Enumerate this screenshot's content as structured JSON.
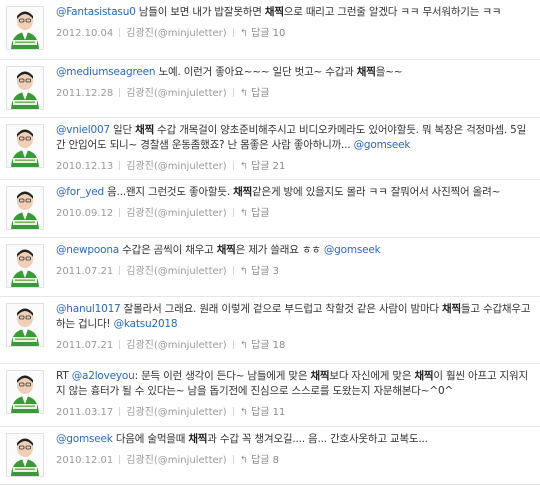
{
  "tweets": [
    {
      "segments": [
        {
          "t": "mention",
          "v": "@Fantasistasu0"
        },
        {
          "t": "text",
          "v": " 남들이 보면 내가 밥잘못하면 "
        },
        {
          "t": "bold",
          "v": "채찍"
        },
        {
          "t": "text",
          "v": "으로 때리고 그런줄 알겠다 ㅋㅋ 무서워하기는 ㅋㅋ"
        }
      ],
      "date": "2012.10.04",
      "author": "김광진(@minjuletter)",
      "reply": "답글 10"
    },
    {
      "segments": [
        {
          "t": "mention",
          "v": "@mediumseagreen"
        },
        {
          "t": "text",
          "v": " 노예. 이런거 좋아요~~~ 일단 벗고~ 수갑과 "
        },
        {
          "t": "bold",
          "v": "채찍"
        },
        {
          "t": "text",
          "v": "을~~"
        }
      ],
      "date": "2011.12.28",
      "author": "김광진(@minjuletter)",
      "reply": "답글"
    },
    {
      "segments": [
        {
          "t": "mention",
          "v": "@vniel007"
        },
        {
          "t": "text",
          "v": " 일단 "
        },
        {
          "t": "bold",
          "v": "채찍"
        },
        {
          "t": "text",
          "v": " 수갑 개목걸이 양초준비해주시고 비디오카메라도 있어야할듯. 뭐 복장은 걱정마셈. 5일간 안입어도 되니~ 경찰샘 운동좀했죠? 난 몸좋은 사람 좋아하니까... "
        },
        {
          "t": "mention",
          "v": "@gomseek"
        }
      ],
      "date": "2010.12.13",
      "author": "김광진(@minjuletter)",
      "reply": "답글 21"
    },
    {
      "segments": [
        {
          "t": "mention",
          "v": "@for_yed"
        },
        {
          "t": "text",
          "v": " 음...왠지 그런것도 좋아할듯. "
        },
        {
          "t": "bold",
          "v": "채찍"
        },
        {
          "t": "text",
          "v": "같은게 방에 있을지도 몰라 ㅋㅋ 잘뭐어서 사진찍어 올려~"
        }
      ],
      "date": "2010.09.12",
      "author": "김광진(@minjuletter)",
      "reply": "답글"
    },
    {
      "segments": [
        {
          "t": "mention",
          "v": "@newpoona"
        },
        {
          "t": "text",
          "v": " 수갑은 곰씩이 채우고 "
        },
        {
          "t": "bold",
          "v": "채찍"
        },
        {
          "t": "text",
          "v": "은 제가 쓸래요 ㅎㅎ "
        },
        {
          "t": "mention",
          "v": "@gomseek"
        }
      ],
      "date": "2011.07.21",
      "author": "김광진(@minjuletter)",
      "reply": "답글 3"
    },
    {
      "segments": [
        {
          "t": "mention",
          "v": "@hanul1017"
        },
        {
          "t": "text",
          "v": " 잘몰라서 그래요. 원래 이렇게 겉으로 부드럽고 착할것 같은 사람이 밤마다 "
        },
        {
          "t": "bold",
          "v": "채찍"
        },
        {
          "t": "text",
          "v": "들고 수갑채우고 하는 겁니다! "
        },
        {
          "t": "mention",
          "v": "@katsu2018"
        }
      ],
      "date": "2011.07.21",
      "author": "김광진(@minjuletter)",
      "reply": "답글 18"
    },
    {
      "segments": [
        {
          "t": "text",
          "v": "RT "
        },
        {
          "t": "mention",
          "v": "@a2loveyou"
        },
        {
          "t": "text",
          "v": ": 문득 이런 생각이 든다~ 남들에게 맞은 "
        },
        {
          "t": "bold",
          "v": "채찍"
        },
        {
          "t": "text",
          "v": "보다 자신에게 맞은 "
        },
        {
          "t": "bold",
          "v": "채찍"
        },
        {
          "t": "text",
          "v": "이 훨씬 아프고 지워지지 않는 흉터가 될 수 있다는~ 남을 돕기전에 진심으로 스스로를 도왔는지 자문해본다~^0^"
        }
      ],
      "date": "2011.03.17",
      "author": "김광진(@minjuletter)",
      "reply": "답글 11"
    },
    {
      "segments": [
        {
          "t": "mention",
          "v": "@gomseek"
        },
        {
          "t": "text",
          "v": " 다음에 술먹을때 "
        },
        {
          "t": "bold",
          "v": "채찍"
        },
        {
          "t": "text",
          "v": "과 수갑 꼭 챙겨오길.... 음... 간호사옷하고 교복도..."
        }
      ],
      "date": "2010.12.01",
      "author": "김광진(@minjuletter)",
      "reply": "답글 8"
    }
  ],
  "avatar_icon": "person-photo-icon",
  "reply_icon": "reply-arrow-icon"
}
